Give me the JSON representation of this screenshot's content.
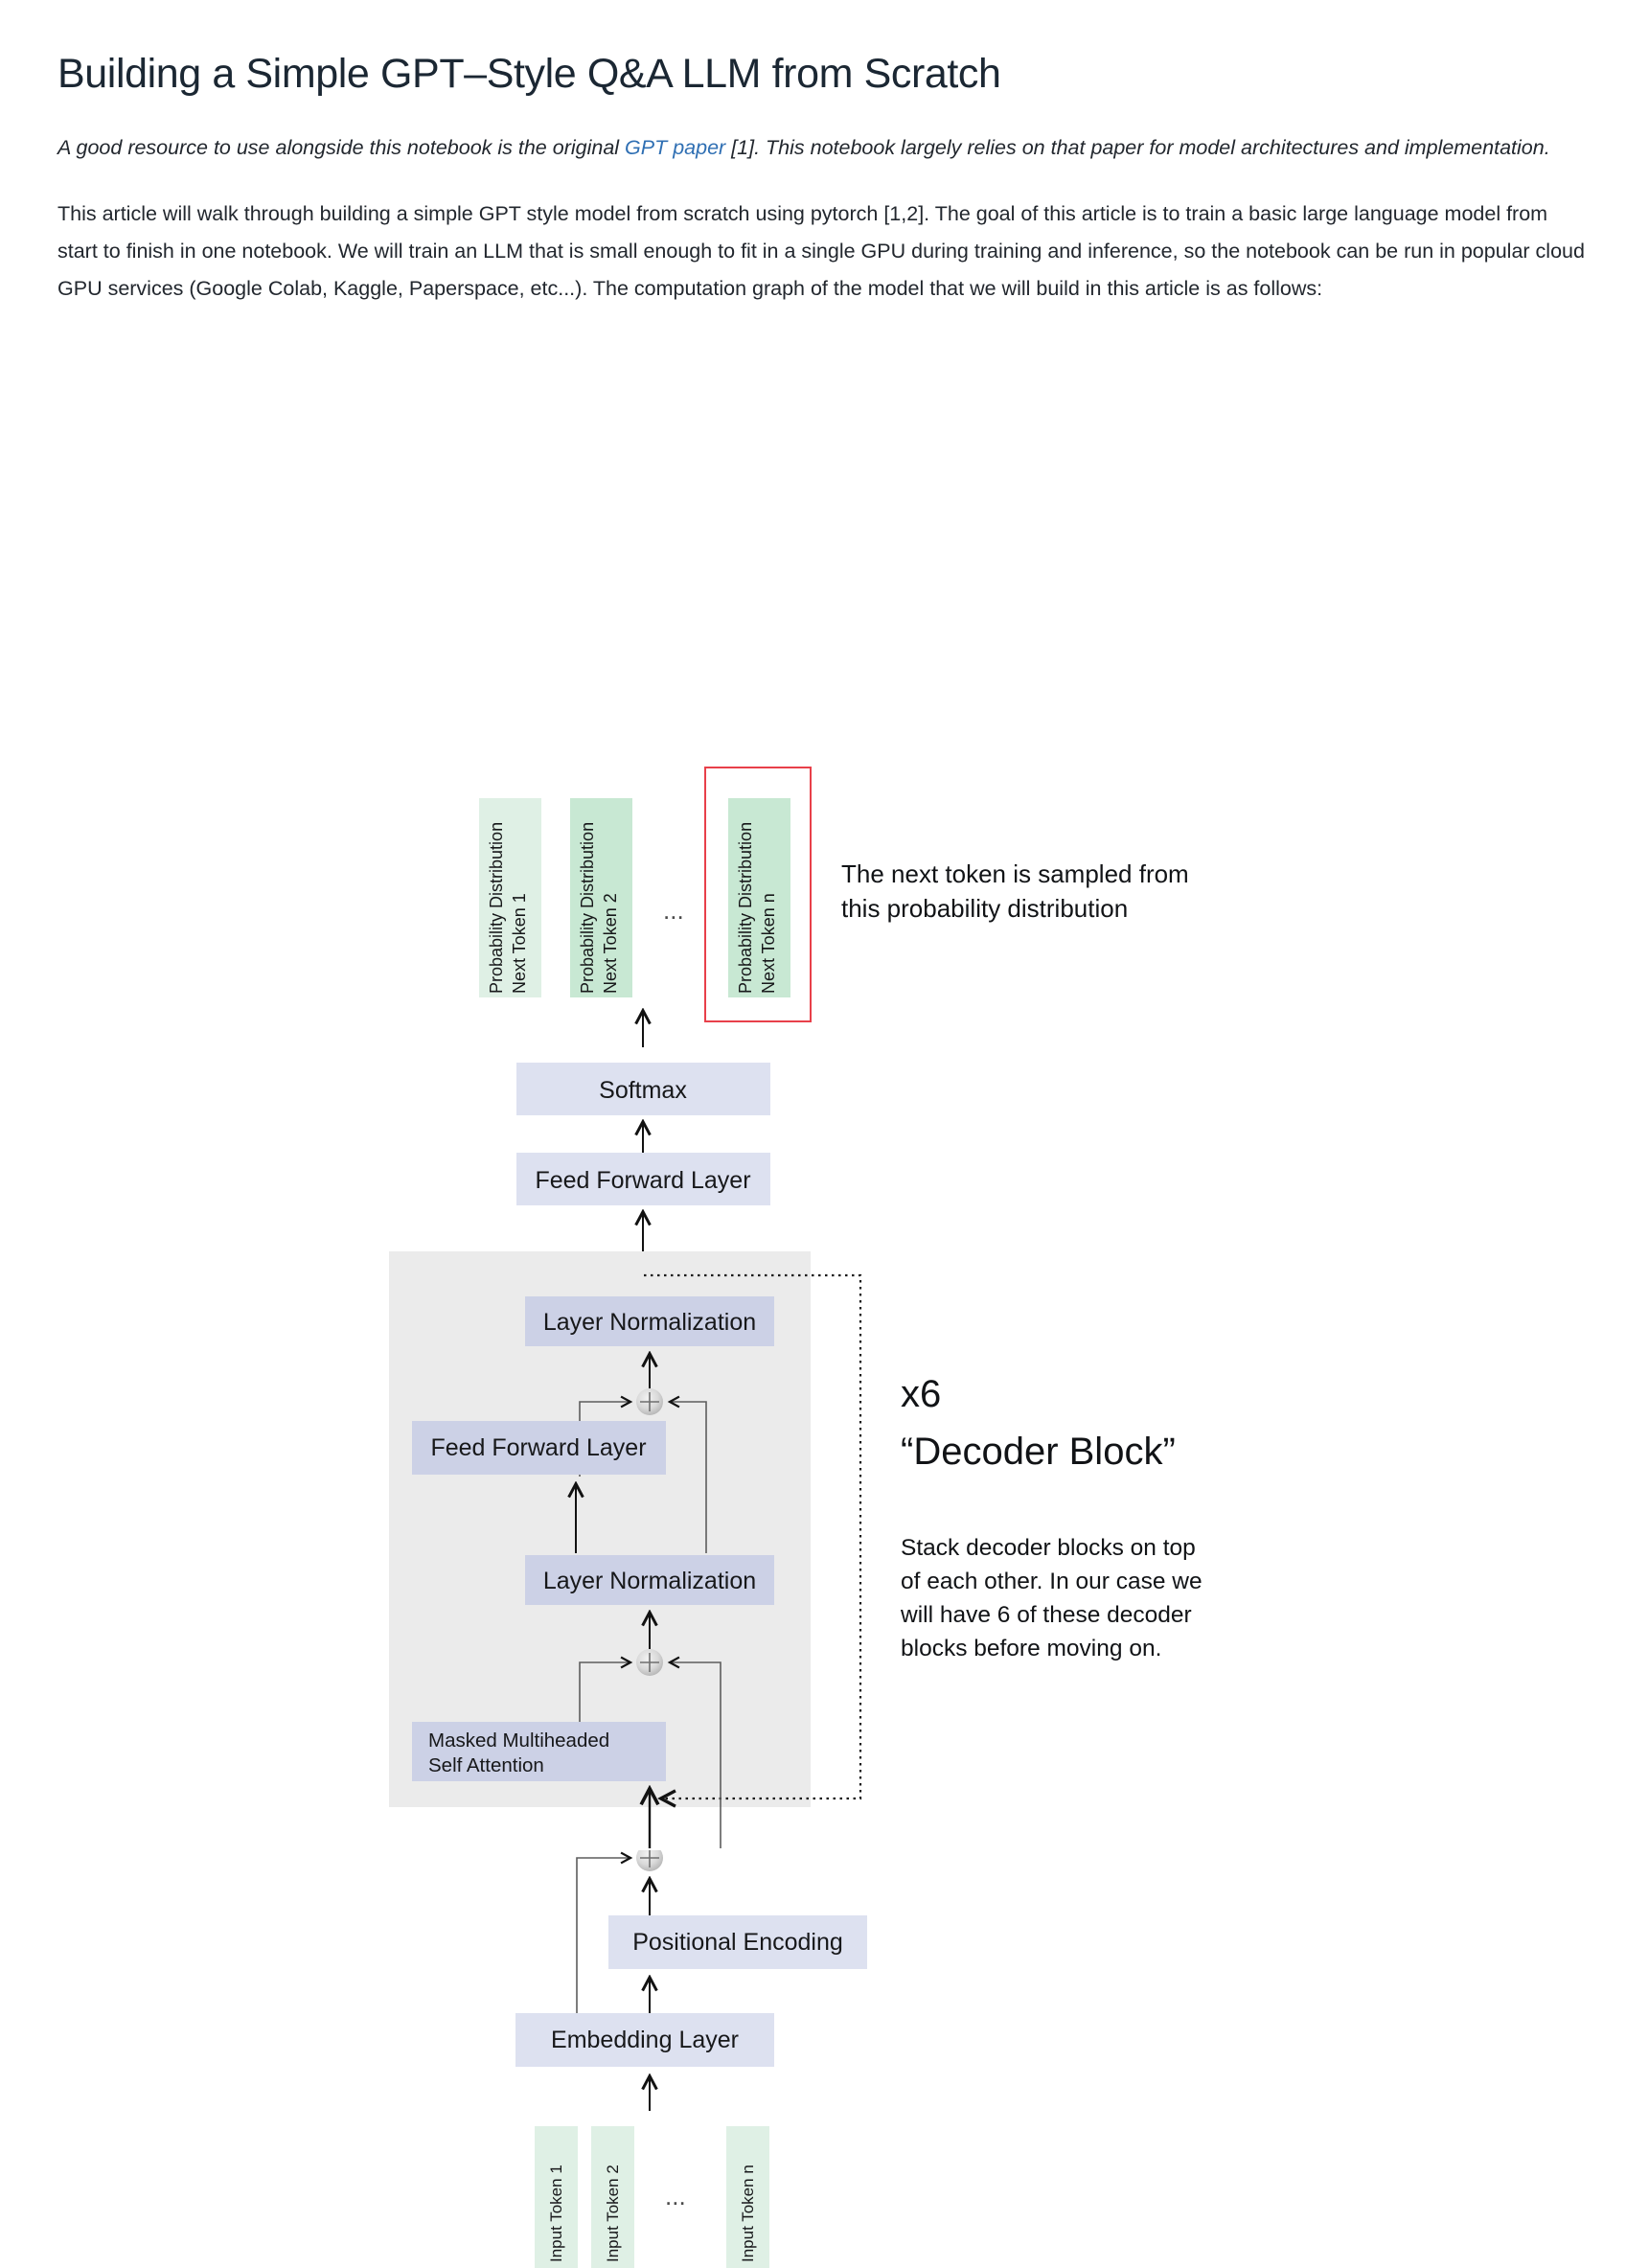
{
  "document": {
    "title": "Building a Simple GPT–Style Q&A LLM from Scratch",
    "lede_before": "A good resource to use alongside this notebook is the original ",
    "lede_link": "GPT paper",
    "lede_after": " [1]. This notebook largely relies on that paper for model architectures and implementation.",
    "body_paragraph": "This article will walk through building a simple GPT style model from scratch using pytorch [1,2]. The goal of this article is to train a basic large language model from start to finish in one notebook. We will train an LLM that is small enough to fit in a single GPU during training and inference, so the notebook can be run in popular cloud GPU services (Google Colab, Kaggle, Paperspace, etc...). The computation graph of the model that we will build in this article is as follows:"
  },
  "diagram": {
    "output_tokens": [
      {
        "label_line1": "Probability Distribution",
        "label_line2": "Next Token 1"
      },
      {
        "label_line1": "Probability Distribution",
        "label_line2": "Next Token 2"
      },
      {
        "label_line1": "Probability Distribution",
        "label_line2": "Next Token n"
      }
    ],
    "output_ellipsis": "...",
    "sampling_note_line1": "The next token is sampled from",
    "sampling_note_line2": "this probability distribution",
    "softmax": "Softmax",
    "final_feed_forward": "Feed Forward Layer",
    "decoder_block": {
      "layer_norm_top": "Layer Normalization",
      "feed_forward": "Feed Forward Layer",
      "layer_norm_bottom": "Layer Normalization",
      "attention_line1": "Masked Multiheaded",
      "attention_line2": "Self Attention"
    },
    "repeat_count": "x6",
    "repeat_title": "“Decoder Block”",
    "repeat_note_line1": "Stack decoder blocks on top",
    "repeat_note_line2": "of each other. In our case we",
    "repeat_note_line3": "will have 6 of these decoder",
    "repeat_note_line4": "blocks before moving on.",
    "positional_encoding": "Positional Encoding",
    "embedding_layer": "Embedding Layer",
    "input_tokens": [
      {
        "label": "Input Token 1"
      },
      {
        "label": "Input Token 2"
      },
      {
        "label": "Input Token n"
      }
    ],
    "input_ellipsis": "..."
  },
  "colors": {
    "green_light": "#dff0e5",
    "green": "#c8e8d3",
    "lavender": "#dde1f0",
    "lavender_dark": "#ccd1e6",
    "gray_block": "#ebebeb",
    "highlight_red": "#e8404a",
    "link_blue": "#2f6fb3",
    "arrow": "#121212"
  }
}
